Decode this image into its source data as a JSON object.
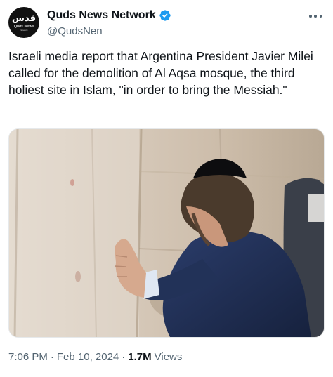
{
  "account": {
    "display_name": "Quds News Network",
    "handle": "@QudsNen",
    "avatar_logo_arabic": "قدس",
    "avatar_logo_english": "Quds News",
    "avatar_logo_tagline": "Network",
    "verified_color": "#1d9bf0"
  },
  "tweet": {
    "text": "Israeli media report that Argentina President Javier Milei called for the demolition of Al Aqsa mosque, the third holiest site in Islam, \"in order to bring the Messiah.\""
  },
  "media": {
    "icon": "photo"
  },
  "meta": {
    "time": "7:06 PM",
    "separator": "·",
    "date": "Feb 10, 2024",
    "separator2": "·",
    "views_count": "1.7M",
    "views_label": "Views"
  },
  "icons": {
    "more": "more-horizontal-icon",
    "verified": "verified-badge-icon"
  },
  "colors": {
    "text_primary": "#0f1419",
    "text_secondary": "#536471",
    "accent": "#1d9bf0"
  }
}
